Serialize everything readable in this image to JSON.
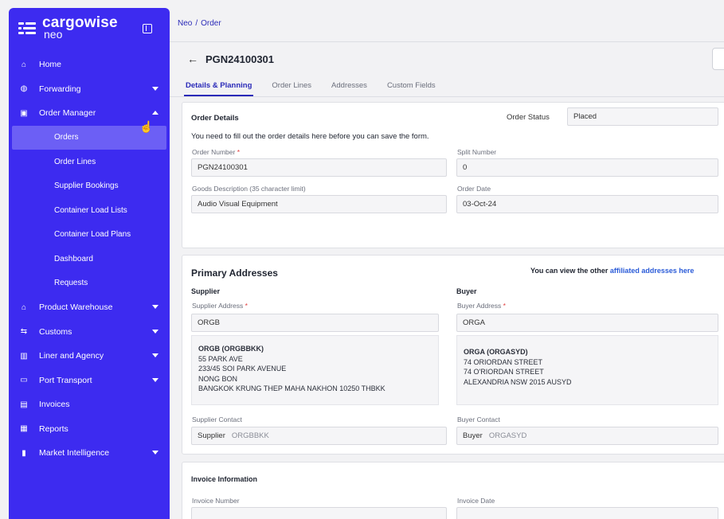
{
  "brand": {
    "name": "cargowise",
    "sub": "neo"
  },
  "sidebar": {
    "items": [
      {
        "label": "Home",
        "icon": "home-icon",
        "glyph": "⌂"
      },
      {
        "label": "Forwarding",
        "icon": "globe-icon",
        "glyph": "◍",
        "caret": "down"
      },
      {
        "label": "Order Manager",
        "icon": "clipboard-icon",
        "glyph": "▣",
        "caret": "up"
      }
    ],
    "order_manager_sub": [
      {
        "label": "Orders",
        "active": true
      },
      {
        "label": "Order Lines"
      },
      {
        "label": "Supplier Bookings"
      },
      {
        "label": "Container Load Lists"
      },
      {
        "label": "Container Load Plans"
      },
      {
        "label": "Dashboard"
      },
      {
        "label": "Requests"
      }
    ],
    "items_after": [
      {
        "label": "Product Warehouse",
        "icon": "warehouse-icon",
        "glyph": "⌂",
        "caret": "down"
      },
      {
        "label": "Customs",
        "icon": "customs-icon",
        "glyph": "⇆",
        "caret": "down"
      },
      {
        "label": "Liner and Agency",
        "icon": "liner-icon",
        "glyph": "▥",
        "caret": "down"
      },
      {
        "label": "Port Transport",
        "icon": "truck-icon",
        "glyph": "▭",
        "caret": "down"
      },
      {
        "label": "Invoices",
        "icon": "invoice-icon",
        "glyph": "▤"
      },
      {
        "label": "Reports",
        "icon": "report-icon",
        "glyph": "▦"
      },
      {
        "label": "Market Intelligence",
        "icon": "chart-icon",
        "glyph": "▮",
        "caret": "down"
      }
    ]
  },
  "breadcrumb": {
    "root": "Neo",
    "separator": "/",
    "current": "Order"
  },
  "header": {
    "order_id": "PGN24100301"
  },
  "tabs": [
    "Details & Planning",
    "Order Lines",
    "Addresses",
    "Custom Fields"
  ],
  "order_details": {
    "title": "Order Details",
    "status_label": "Order Status",
    "status_value": "Placed",
    "notice": "You need to fill out the order details here before you can save the form.",
    "order_number_label": "Order Number",
    "order_number_value": "PGN24100301",
    "split_number_label": "Split Number",
    "split_number_value": "0",
    "goods_desc_label": "Goods Description (35 character limit)",
    "goods_desc_value": "Audio Visual Equipment",
    "order_date_label": "Order Date",
    "order_date_value": "03-Oct-24"
  },
  "primary_addresses": {
    "title": "Primary Addresses",
    "note_prefix": "You can view the other",
    "note_link": "affiliated addresses here",
    "supplier": {
      "heading": "Supplier",
      "address_label": "Supplier Address",
      "address_value": "ORGB",
      "block_name": "ORGB (ORGBBKK)",
      "block_lines": [
        "55 PARK AVE",
        "233/45 SOI PARK AVENUE",
        "NONG BON",
        "BANGKOK KRUNG THEP MAHA NAKHON 10250 THBKK"
      ],
      "contact_label": "Supplier Contact",
      "contact_prefix": "Supplier",
      "contact_value": "ORGBBKK"
    },
    "buyer": {
      "heading": "Buyer",
      "address_label": "Buyer Address",
      "address_value": "ORGA",
      "block_name": "ORGA (ORGASYD)",
      "block_lines": [
        "74 ORIORDAN STREET",
        "74 O'RIORDAN STREET",
        "ALEXANDRIA NSW 2015 AUSYD"
      ],
      "contact_label": "Buyer Contact",
      "contact_prefix": "Buyer",
      "contact_value": "ORGASYD"
    }
  },
  "invoice_info": {
    "title": "Invoice Information",
    "invoice_number_label": "Invoice Number",
    "invoice_date_label": "Invoice Date"
  },
  "colors": {
    "sidebar": "#3d2bf0",
    "accent": "#2a2ab8",
    "active_item": "#6c5ff5"
  }
}
